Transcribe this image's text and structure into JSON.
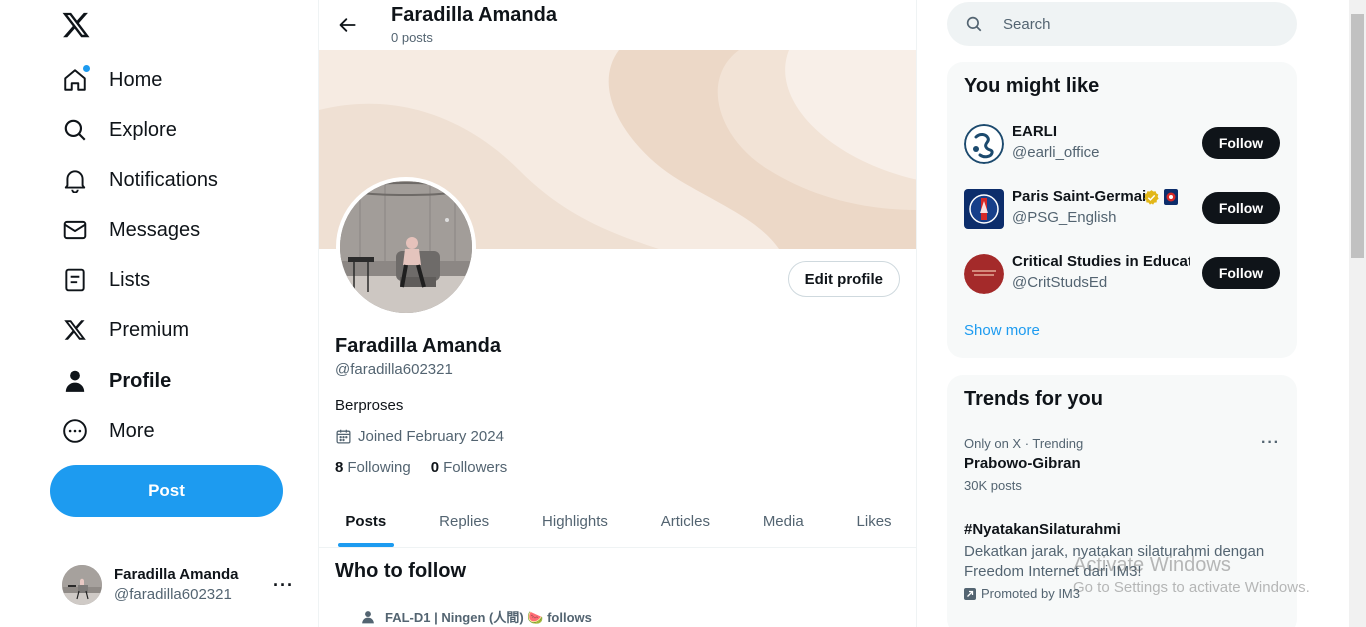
{
  "nav": {
    "items": [
      {
        "label": "Home",
        "icon": "home-icon"
      },
      {
        "label": "Explore",
        "icon": "search-icon"
      },
      {
        "label": "Notifications",
        "icon": "bell-icon"
      },
      {
        "label": "Messages",
        "icon": "envelope-icon"
      },
      {
        "label": "Lists",
        "icon": "list-icon"
      },
      {
        "label": "Premium",
        "icon": "x-logo-icon"
      },
      {
        "label": "Profile",
        "icon": "person-icon"
      },
      {
        "label": "More",
        "icon": "more-circle-icon"
      }
    ],
    "active": "Profile",
    "post_label": "Post"
  },
  "account": {
    "name": "Faradilla Amanda",
    "handle": "@faradilla602321",
    "more": "···"
  },
  "header": {
    "name": "Faradilla Amanda",
    "posts": "0 posts"
  },
  "profile": {
    "name": "Faradilla Amanda",
    "handle": "@faradilla602321",
    "bio": "Berproses",
    "joined": "Joined February 2024",
    "following_count": "8",
    "following_label": "Following",
    "followers_count": "0",
    "followers_label": "Followers",
    "edit_label": "Edit profile"
  },
  "tabs": [
    "Posts",
    "Replies",
    "Highlights",
    "Articles",
    "Media",
    "Likes"
  ],
  "active_tab": "Posts",
  "who_to_follow": {
    "title": "Who to follow",
    "follows_text": "FAL-D1 | Ningen (人間) 🍉 follows"
  },
  "search": {
    "placeholder": "Search"
  },
  "you_might_like": {
    "title": "You might like",
    "users": [
      {
        "name": "EARLI",
        "handle": "@earli_office",
        "verified": false
      },
      {
        "name": "Paris Saint-Germain",
        "handle": "@PSG_English",
        "verified": true
      },
      {
        "name": "Critical Studies in Education",
        "handle": "@CritStudsEd",
        "verified": false
      }
    ],
    "follow_label": "Follow",
    "show_more": "Show more"
  },
  "trends": {
    "title": "Trends for you",
    "items": [
      {
        "meta": "Only on X · Trending",
        "name": "Prabowo-Gibran",
        "posts": "30K posts"
      },
      {
        "name": "#NyatakanSilaturahmi",
        "desc": "Dekatkan jarak, nyatakan silaturahmi dengan Freedom Internet dari IM3!",
        "promoted": "Promoted by IM3"
      }
    ],
    "more": "···"
  },
  "watermark": {
    "title": "Activate Windows",
    "subtitle": "Go to Settings to activate Windows."
  },
  "colors": {
    "accent": "#1d9bf0",
    "text": "#0f1419",
    "muted": "#536471",
    "follow_bg": "#0f1419",
    "card_bg": "#f7f9f9"
  }
}
